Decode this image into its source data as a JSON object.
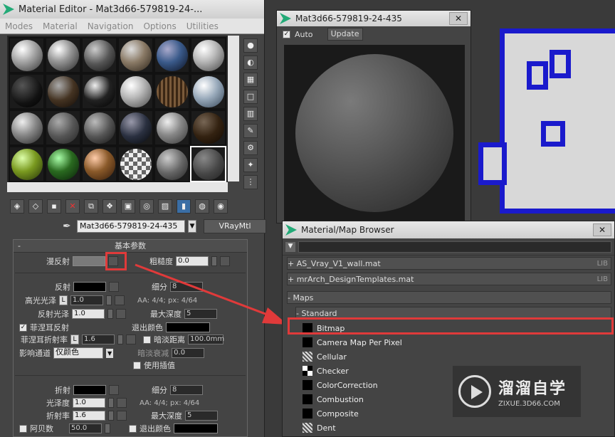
{
  "editor": {
    "title": "Material Editor - Mat3d66-579819-24-...",
    "menus": [
      "Modes",
      "Material",
      "Navigation",
      "Options",
      "Utilities"
    ],
    "material_name": "Mat3d66-579819-24-435",
    "material_type": "VRayMtl",
    "rollout_title": "基本参数",
    "rollout_toggle": "-",
    "diffuse_label": "漫反射",
    "roughness_label": "粗糙度",
    "roughness_value": "0.0",
    "reflect_label": "反射",
    "subdiv_label": "细分",
    "subdiv_value": "8",
    "hilight_gloss_label": "高光光泽",
    "hilight_gloss_value": "1.0",
    "aa_text": "AA: 4/4; px: 4/64",
    "refl_gloss_label": "反射光泽",
    "refl_gloss_value": "1.0",
    "max_depth_label": "最大深度",
    "max_depth_value": "5",
    "fresnel_label": "菲涅耳反射",
    "exit_color_label": "退出颜色",
    "fresnel_ior_label": "菲涅耳折射率",
    "fresnel_ior_value": "1.6",
    "dim_dist_label": "暗淡距离",
    "dim_dist_value": "100.0mm",
    "affect_channels_label": "影响通道",
    "affect_channels_value": "仅颜色",
    "dim_falloff_label": "暗淡衰减",
    "dim_falloff_value": "0.0",
    "use_interp_label": "使用插值",
    "refract_label": "折射",
    "refract_subdiv_label": "细分",
    "refract_subdiv_value": "8",
    "gloss_label": "光泽度",
    "gloss_value": "1.0",
    "refract_aa_text": "AA: 4/4; px: 4/64",
    "ior_label": "折射率",
    "ior_value": "1.6",
    "refract_max_depth_label": "最大深度",
    "refract_max_depth_value": "5",
    "abbe_label": "阿贝数",
    "abbe_value": "50.0",
    "refract_exit_color_label": "退出颜色",
    "l_label": "L"
  },
  "preview": {
    "title": "Mat3d66-579819-24-435",
    "auto_label": "Auto",
    "update_label": "Update"
  },
  "browser": {
    "title": "Material/Map Browser",
    "libs": [
      {
        "label": "+ AS_Vray_V1_wall.mat",
        "tag": "LIB"
      },
      {
        "label": "+ mrArch_DesignTemplates.mat",
        "tag": "LIB"
      }
    ],
    "maps_header": "- Maps",
    "standard_header": "- Standard",
    "maps": [
      "Bitmap",
      "Camera Map Per Pixel",
      "Cellular",
      "Checker",
      "ColorCorrection",
      "Combustion",
      "Composite",
      "Dent"
    ]
  },
  "watermark": {
    "cn": "溜溜自学",
    "url": "ZIXUE.3D66.COM"
  },
  "colors": {
    "highlight": "#e03a3a",
    "panel_blue": "#1a1acc"
  }
}
